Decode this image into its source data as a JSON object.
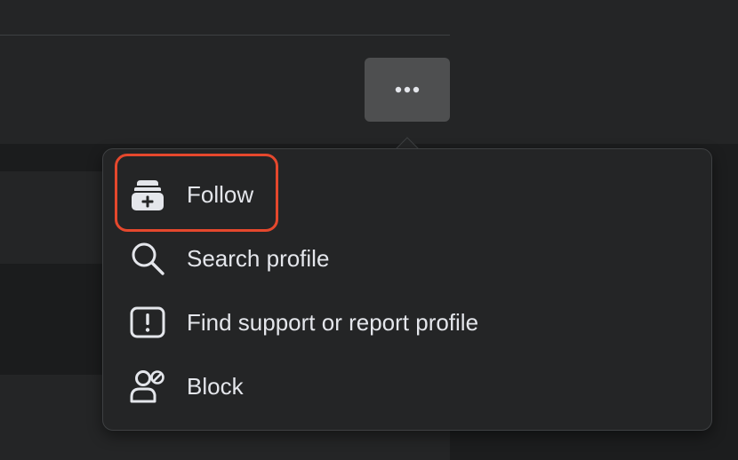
{
  "more_button": {
    "icon": "more-horizontal-icon"
  },
  "menu": {
    "items": [
      {
        "label": "Follow",
        "icon": "follow-icon"
      },
      {
        "label": "Search profile",
        "icon": "search-icon"
      },
      {
        "label": "Find support or report profile",
        "icon": "report-icon"
      },
      {
        "label": "Block",
        "icon": "block-user-icon"
      }
    ],
    "highlighted_item": "Follow"
  },
  "colors": {
    "highlight": "#e5482d",
    "menu_background": "#242526",
    "text": "#e4e6eb"
  }
}
